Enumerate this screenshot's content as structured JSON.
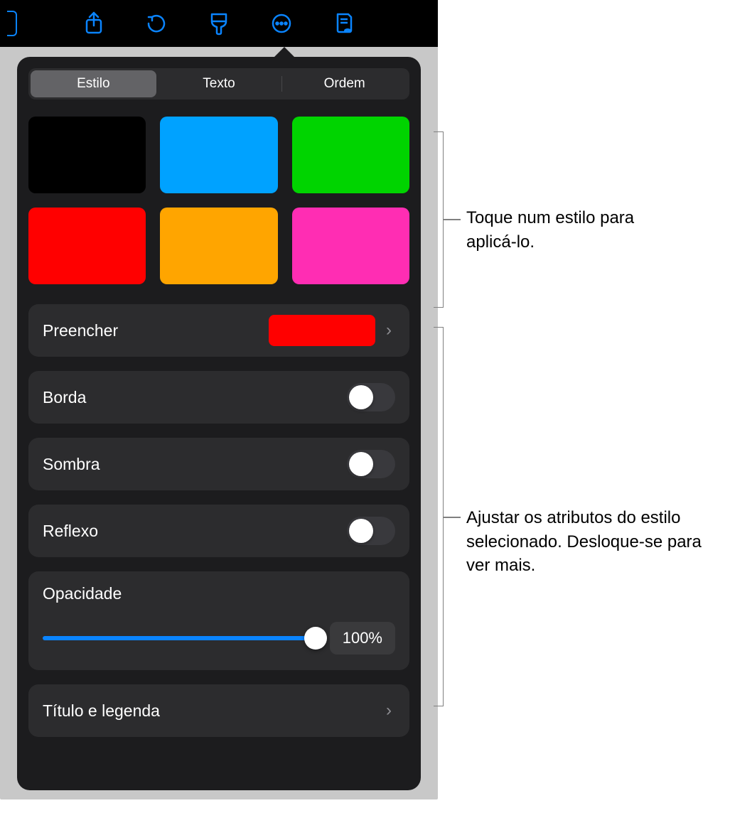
{
  "toolbar": {
    "icons": [
      "share-icon",
      "undo-icon",
      "format-brush-icon",
      "more-icon",
      "document-preview-icon"
    ]
  },
  "tabs": {
    "items": [
      {
        "label": "Estilo",
        "active": true
      },
      {
        "label": "Texto",
        "active": false
      },
      {
        "label": "Ordem",
        "active": false
      }
    ]
  },
  "swatches": [
    {
      "name": "black",
      "color": "#000000"
    },
    {
      "name": "blue",
      "color": "#00a2ff"
    },
    {
      "name": "green",
      "color": "#00d400"
    },
    {
      "name": "red",
      "color": "#ff0000"
    },
    {
      "name": "orange",
      "color": "#ffa500"
    },
    {
      "name": "magenta",
      "color": "#ff2db3"
    }
  ],
  "rows": {
    "fill": {
      "label": "Preencher",
      "preview_color": "#ff0000"
    },
    "border": {
      "label": "Borda",
      "on": false
    },
    "shadow": {
      "label": "Sombra",
      "on": false
    },
    "reflection": {
      "label": "Reflexo",
      "on": false
    },
    "opacity": {
      "label": "Opacidade",
      "value_text": "100%",
      "value": 100
    },
    "title_caption": {
      "label": "Título e legenda"
    }
  },
  "callouts": {
    "style_tap": "Toque num estilo para aplicá-lo.",
    "attributes": "Ajustar os atributos do estilo selecionado. Desloque-se para ver mais."
  }
}
